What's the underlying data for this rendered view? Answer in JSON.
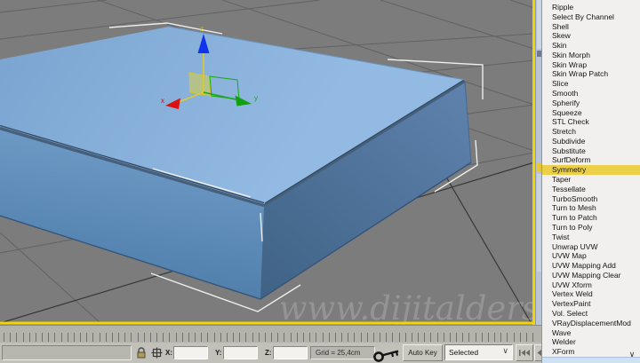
{
  "viewport": {
    "watermark": "www.dijitalders",
    "background": "#7c7c7c",
    "border_color": "#f2d500",
    "grid_line_color": "#636363",
    "grid_axis_color": "#383838",
    "object": {
      "name": "blue-box",
      "top_color": "#8ab1db",
      "front_color": "#5f8cb8",
      "side_color": "#4d7099",
      "selection_bracket_color": "#eeeeee"
    },
    "gizmo": {
      "x_label": "x",
      "y_label": "y",
      "z_label": "z",
      "x_color": "#dd1111",
      "y_color": "#18a818",
      "z_color": "#1133ee",
      "highlight_color": "#e0ca25"
    }
  },
  "modifier_list": {
    "items": [
      "Ripple",
      "Select By Channel",
      "Shell",
      "Skew",
      "Skin",
      "Skin Morph",
      "Skin Wrap",
      "Skin Wrap Patch",
      "Slice",
      "Smooth",
      "Spherify",
      "Squeeze",
      "STL Check",
      "Stretch",
      "Subdivide",
      "Substitute",
      "SurfDeform",
      "Symmetry",
      "Taper",
      "Tessellate",
      "TurboSmooth",
      "Turn to Mesh",
      "Turn to Patch",
      "Turn to Poly",
      "Twist",
      "Unwrap UVW",
      "UVW Map",
      "UVW Mapping Add",
      "UVW Mapping Clear",
      "UVW Xform",
      "Vertex Weld",
      "VertexPaint",
      "Vol. Select",
      "VRayDisplacementMod",
      "Wave",
      "Welder",
      "XForm"
    ],
    "highlighted_item": "Symmetry",
    "highlight_color": "#ecd04a",
    "scroll_down_arrow": "∨"
  },
  "status_bar": {
    "prompt_value": "",
    "x_label": "X:",
    "y_label": "Y:",
    "z_label": "Z:",
    "x_value": "",
    "y_value": "",
    "z_value": "",
    "grid_label": "Grid = 25,4cm",
    "auto_key_label": "Auto Key",
    "key_filter_value": "Selected",
    "icons": [
      "selection-lock-icon",
      "transform-typein-icon",
      "set-key-icon",
      "go-to-start-icon",
      "previous-frame-icon"
    ]
  }
}
